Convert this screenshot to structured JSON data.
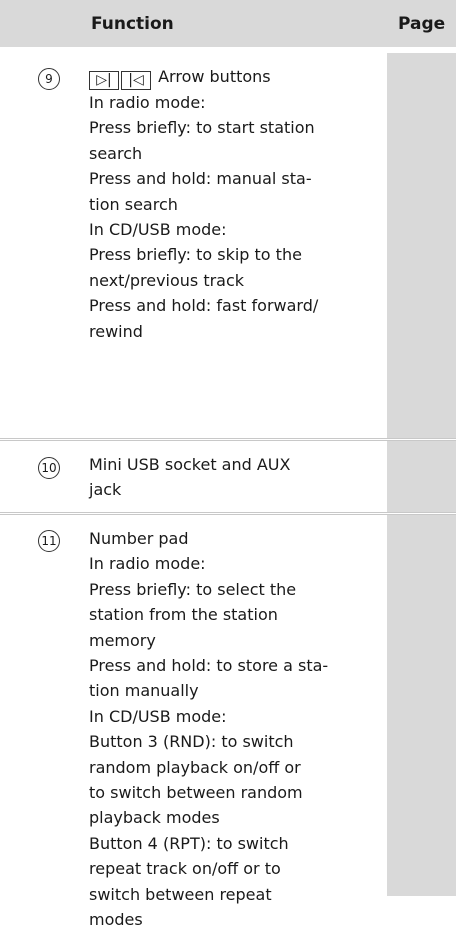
{
  "header": {
    "function_label": "Function",
    "page_label": "Page"
  },
  "rows": [
    {
      "number": "9",
      "buttons": [
        "▷|",
        "|◁"
      ],
      "buttons_text": "Arrow buttons",
      "lines": [
        "In radio mode:",
        "Press briefly: to start station",
        "search",
        "Press and hold: manual sta-",
        "tion search",
        "In CD/USB mode:",
        "Press briefly: to skip to the",
        "next/previous track",
        "Press and hold: fast forward/",
        "rewind"
      ]
    },
    {
      "number": "10",
      "lines": [
        "Mini USB socket and AUX",
        "jack"
      ]
    },
    {
      "number": "11",
      "lines": [
        "Number pad",
        "In radio mode:",
        "Press briefly: to select the",
        "station from the station",
        "memory",
        "Press and hold: to store a sta-",
        "tion manually",
        "In CD/USB mode:",
        "Button 3 (RND): to switch",
        "random playback on/off or",
        "to switch between random",
        "playback modes",
        "Button 4 (RPT): to switch",
        "repeat track on/off or to",
        "switch between repeat",
        "modes"
      ]
    }
  ]
}
